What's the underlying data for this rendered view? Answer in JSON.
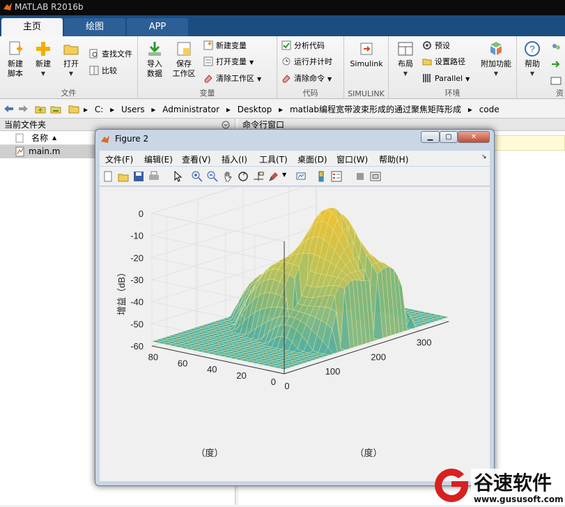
{
  "window": {
    "title": "MATLAB R2016b"
  },
  "tabs": [
    {
      "label": "主页"
    },
    {
      "label": "绘图"
    },
    {
      "label": "APP"
    }
  ],
  "ribbon": {
    "file_group": {
      "caption": "文件",
      "new_script": "新建\n脚本",
      "new": "新建",
      "open": "打开",
      "find_files": "查找文件",
      "compare": "比较"
    },
    "variable_group": {
      "caption": "变量",
      "import": "导入\n数据",
      "save_ws": "保存\n工作区",
      "new_var": "新建变量",
      "open_var": "打开变量",
      "clear_ws": "清除工作区"
    },
    "code_group": {
      "caption": "代码",
      "analyze": "分析代码",
      "run_time": "运行并计时",
      "clear_cmd": "清除命令"
    },
    "simulink_group": {
      "caption": "SIMULINK",
      "simulink": "Simulink"
    },
    "env_group": {
      "caption": "环境",
      "layout": "布局",
      "prefs": "预设",
      "set_path": "设置路径",
      "parallel": "Parallel",
      "addons": "附加功能"
    },
    "resources_group": {
      "help": "帮助",
      "caption": "资"
    }
  },
  "address": {
    "path": [
      "C:",
      "Users",
      "Administrator",
      "Desktop",
      "matlab编程宽带波束形成的通过聚焦矩阵形成",
      "code"
    ]
  },
  "current_folder": {
    "title": "当前文件夹",
    "column_name": "名称",
    "files": [
      "main.m"
    ]
  },
  "command_window": {
    "title": "命令行窗口"
  },
  "figure": {
    "title": "Figure 2",
    "menu": [
      "文件(F)",
      "编辑(E)",
      "查看(V)",
      "插入(I)",
      "工具(T)",
      "桌面(D)",
      "窗口(W)",
      "帮助(H)"
    ]
  },
  "chart_data": {
    "type": "surface",
    "zlabel": "增益（dB）",
    "xlabel": "（度）",
    "ylabel": "（度）",
    "z_ticks": [
      "0",
      "-10",
      "-20",
      "-30",
      "-40",
      "-50",
      "-60"
    ],
    "zlim": [
      -60,
      0
    ],
    "x_ticks": [
      "0",
      "100",
      "200",
      "300"
    ],
    "xlim": [
      0,
      360
    ],
    "y_ticks": [
      "0",
      "20",
      "40",
      "60",
      "80"
    ],
    "ylim": [
      0,
      90
    ],
    "grid": true,
    "colormap": [
      "#3fa9a5",
      "#b9c25a",
      "#f2c230"
    ]
  },
  "watermark": {
    "brand": "谷速软件",
    "url": "www.gususoft.com"
  },
  "colors": {
    "tab_bar": "#1c4d80",
    "accent": "#f2c230"
  }
}
